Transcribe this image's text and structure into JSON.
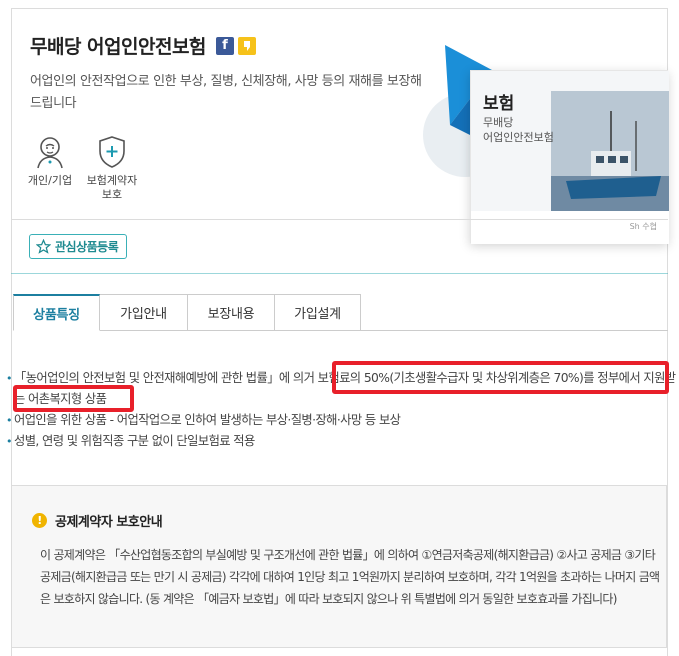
{
  "product": {
    "title": "무배당 어업인안전보험",
    "description": "어업인의 안전작업으로 인한 부상, 질병, 신체장해, 사망 등의 재해를 보장해 드립니다"
  },
  "sns": {
    "facebook_icon": "f",
    "kakao_icon": "talk"
  },
  "features": [
    {
      "label": "개인/기업",
      "icon": "person-icon"
    },
    {
      "label": "보험계약자 보호",
      "icon": "shield-plus-icon"
    }
  ],
  "card": {
    "title": "보험",
    "subtitle_line1": "무배당",
    "subtitle_line2": "어업인안전보험",
    "logo": "Sh 수협"
  },
  "wishlist_label": "관심상품등록",
  "tabs": [
    {
      "label": "상품특징",
      "active": true
    },
    {
      "label": "가입안내",
      "active": false
    },
    {
      "label": "보장내용",
      "active": false
    },
    {
      "label": "가입설계",
      "active": false
    }
  ],
  "bullets": [
    "「농어업인의 안전보험 및 안전재해예방에 관한 법률」에 의거 보험료의 50%(기초생활수급자 및 차상위계층은 70%)를 정부에서 지원받는 어촌복지형 상품",
    "어업인을 위한 상품 - 어업작업으로 인하여 발생하는 부상·질병·장해·사망 등 보상",
    "성별, 연령 및 위험직종 구분 없이 단일보험료 적용"
  ],
  "notice": {
    "title": "공제계약자 보호안내",
    "body": "이 공제계약은 「수산업협동조합의 부실예방 및 구조개선에 관한 법률」에 의하여 ①연금저축공제(해지환급금) ②사고 공제금 ③기타공제금(해지환급금 또는 만기 시 공제금) 각각에 대하여 1인당 최고 1억원까지 분리하여 보호하며, 각각 1억원을 초과하는 나머지 금액은 보호하지 않습니다. (동 계약은 「예금자 보호법」에 따라 보호되지 않으나 위 특별법에 의거 동일한 보호효과를 가집니다)"
  },
  "colors": {
    "accent": "#1c7fa0",
    "highlight": "#e8202a",
    "teal": "#3ab0b7"
  }
}
